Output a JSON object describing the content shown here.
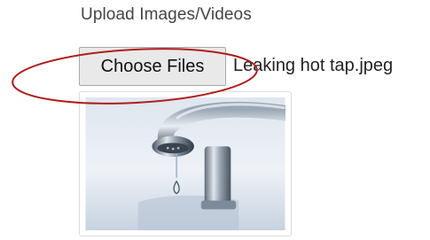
{
  "upload": {
    "heading": "Upload Images/Videos",
    "choose_button_label": "Choose Files",
    "selected_file_name": "Leaking hot tap.jpeg"
  },
  "preview": {
    "image_icon": "leaking-tap-photo"
  },
  "annotation": {
    "shape": "ellipse",
    "color": "#b01c1c"
  }
}
